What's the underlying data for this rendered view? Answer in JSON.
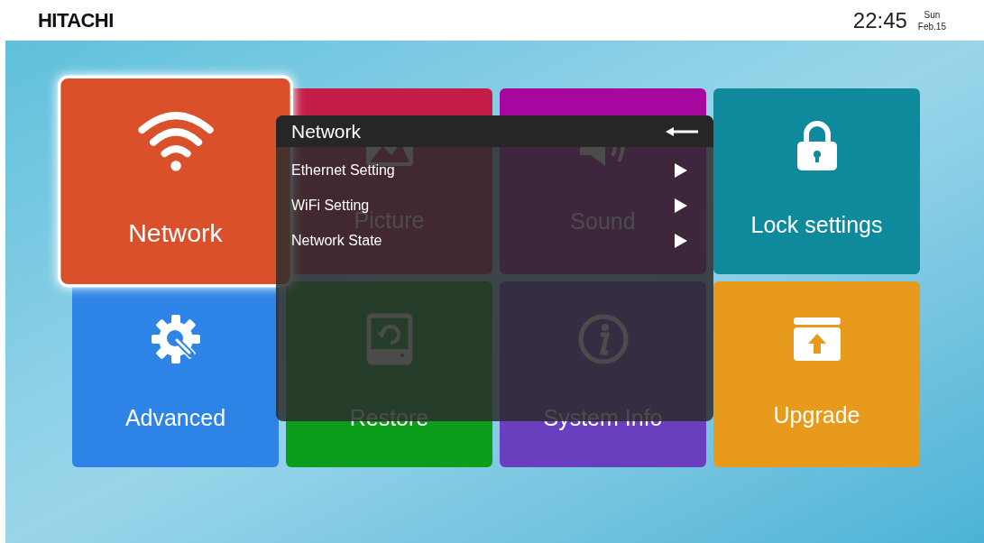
{
  "header": {
    "brand": "HITACHI",
    "time": "22:45",
    "day": "Sun",
    "date": "Feb.15"
  },
  "tiles": [
    {
      "label": "Network",
      "kind": "wifi",
      "color": "#d9502b",
      "selected": true
    },
    {
      "label": "Picture",
      "kind": "picture",
      "color": "#c41d4a",
      "selected": false
    },
    {
      "label": "Sound",
      "kind": "sound",
      "color": "#a5079f",
      "selected": false
    },
    {
      "label": "Lock settings",
      "kind": "lock",
      "color": "#0e8a9c",
      "selected": false
    },
    {
      "label": "Advanced",
      "kind": "gear",
      "color": "#2d84e6",
      "selected": false
    },
    {
      "label": "Restore",
      "kind": "restore",
      "color": "#0c9e1b",
      "selected": false
    },
    {
      "label": "System Info",
      "kind": "info",
      "color": "#6a3fbf",
      "selected": false
    },
    {
      "label": "Upgrade",
      "kind": "upgrade",
      "color": "#e89a1c",
      "selected": false
    }
  ],
  "popup": {
    "title": "Network",
    "items": [
      {
        "label": "Ethernet Setting"
      },
      {
        "label": "WiFi Setting"
      },
      {
        "label": "Network State"
      }
    ]
  }
}
